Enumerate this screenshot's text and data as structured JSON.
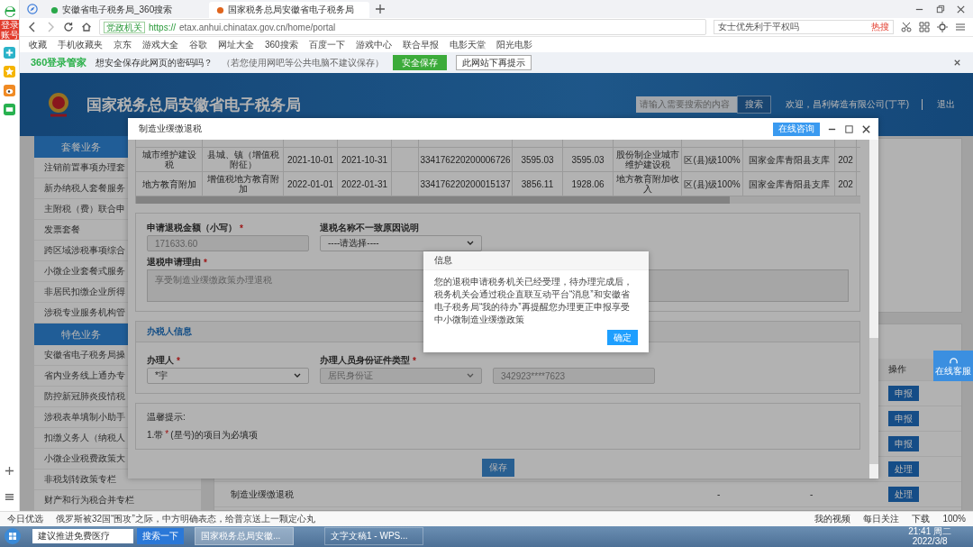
{
  "browser": {
    "tabs": [
      {
        "title": "安徽省电子税务局_360搜索",
        "selected": false
      },
      {
        "title": "国家税务总局安徽省电子税务局",
        "selected": true
      }
    ],
    "address": {
      "badge": "党政机关",
      "scheme": "https://",
      "rest": "etax.anhui.chinatax.gov.cn/home/portal"
    },
    "search": {
      "placeholder": "女士优先利于平权吗",
      "hot": "热搜"
    },
    "bookmarks": [
      "收藏",
      "手机收藏夹",
      "京东",
      "游戏大全",
      "谷歌",
      "网址大全",
      "360搜索",
      "百度一下",
      "游戏中心",
      "联合早报",
      "电影天堂",
      "阳光电影"
    ],
    "password_bar": {
      "brand": "360登录管家",
      "question": "想安全保存此网页的密码吗？",
      "note": "（若您使用网吧等公共电脑不建议保存）",
      "save": "安全保存",
      "dismiss": "此网站下再提示"
    }
  },
  "side_strip": {
    "badge": "登录账号"
  },
  "site": {
    "title": "国家税务总局安徽省电子税务局",
    "search_placeholder": "请输入需要搜索的内容",
    "search_button": "搜索",
    "welcome": "欢迎，昌利铸造有限公司(丁平)",
    "logout": "退出"
  },
  "sidebar": {
    "sections": [
      {
        "title": "套餐业务",
        "items": [
          "注销前置事项办理套",
          "新办纳税人套餐服务",
          "主附税（费）联合申",
          "发票套餐",
          "跨区域涉税事项综合",
          "小微企业套餐式服务",
          "非居民扣缴企业所得",
          "涉税专业服务机构管"
        ]
      },
      {
        "title": "特色业务",
        "items": [
          "安徽省电子税务局操",
          "省内业务线上通办专",
          "防控新冠肺炎疫情税",
          "涉税表单填制小助手",
          "扣缴义务人（纳税人",
          "小微企业税费政策大",
          "非税划转政策专栏",
          "财产和行为税合并专栏"
        ]
      }
    ]
  },
  "table": {
    "columns": [
      "操作"
    ],
    "rows": [
      {
        "action": "申报"
      },
      {
        "action": "申报"
      },
      {
        "action": "申报"
      },
      {
        "action": "处理"
      },
      {
        "name": "制造业缓缴退税",
        "column_2": "-",
        "column_3": "-",
        "action": "处理"
      }
    ]
  },
  "service_button": "在线客服",
  "dialog": {
    "title": "制造业缓缴退税",
    "consult_button": "在线咨询",
    "rows": [
      {
        "tax": "城市维护建设税",
        "item": "县城、镇（增值税附征）",
        "start": "2021-10-01",
        "end": "2021-10-31",
        "ticket": "334176220200006726",
        "amount": "3595.03",
        "refund": "3595.03",
        "income": "股份制企业城市维护建设税",
        "level": "区(县)级100%",
        "treasury": "国家金库青阳县支库",
        "column_12": "202"
      },
      {
        "tax": "地方教育附加",
        "item": "增值税地方教育附加",
        "start": "2022-01-01",
        "end": "2022-01-31",
        "ticket": "334176220200015137",
        "amount": "3856.11",
        "refund": "1928.06",
        "income": "地方教育附加收入",
        "level": "区(县)级100%",
        "treasury": "国家金库青阳县支库",
        "column_12": "202"
      }
    ],
    "amount": {
      "label": "申请退税金额（小写）",
      "mark": "*",
      "value": "171633.60"
    },
    "mismatch": {
      "label": "退税名称不一致原因说明",
      "value": "----请选择----"
    },
    "reason": {
      "label": "退税申请理由",
      "mark": "*",
      "value": "享受制造业缓缴政策办理退税"
    },
    "agent_section": "办税人信息",
    "agent": {
      "label": "办理人",
      "mark": "*",
      "value": "*宇"
    },
    "id_type": {
      "label": "办理人员身份证件类型",
      "mark": "*",
      "value": "居民身份证"
    },
    "id_number": {
      "value": "342923****7623"
    },
    "tips": {
      "title": "温馨提示:",
      "before": "1.带",
      "mark": "*",
      "after": "(星号)的项目为必填项"
    },
    "save": "保存"
  },
  "modal": {
    "title": "信息",
    "message": "您的退税申请税务机关已经受理，待办理完成后，税务机关会通过税企直联互动平台“消息”和安徽省电子税务局“我的待办”再提醒您办理更正申报享受中小微制造业缓缴政策",
    "ok": "确定"
  },
  "status_bar": {
    "today": "今日优选",
    "news": "俄罗斯被32国“围攻”之际，中方明确表态，给普京送上一颗定心丸",
    "video": "我的视频",
    "daily": "每日关注",
    "download": "下载",
    "zoom": "100%"
  },
  "taskbar": {
    "search": "建议推进免费医疗",
    "search_button": "搜索一下",
    "tasks": [
      {
        "title": "国家税务总局安徽...",
        "selected": true
      },
      {
        "title": "文字文稿1 - WPS...",
        "selected": false
      }
    ],
    "time": "21:41 周二",
    "date": "2022/3/8"
  }
}
